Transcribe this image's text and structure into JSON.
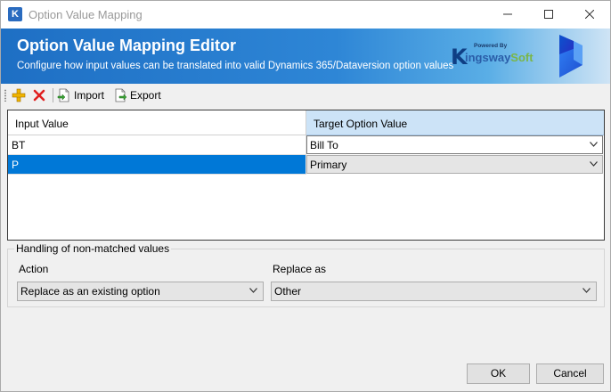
{
  "window": {
    "title": "Option Value Mapping",
    "app_icon_letter": "K"
  },
  "banner": {
    "title": "Option Value Mapping Editor",
    "subtitle": "Configure how input values can be translated into valid Dynamics 365/Dataversion option values",
    "brand": {
      "powered_by": "Powered By",
      "k_letter": "K",
      "name_part1": "ingsway",
      "name_part2": "Soft"
    }
  },
  "toolbar": {
    "import_label": "Import",
    "export_label": "Export"
  },
  "grid": {
    "columns": [
      "Input Value",
      "Target Option Value"
    ],
    "rows": [
      {
        "input": "BT",
        "target": "Bill To"
      },
      {
        "input": "P",
        "target": "Primary"
      }
    ]
  },
  "non_matched": {
    "legend": "Handling of non-matched values",
    "action_label": "Action",
    "action_value": "Replace as an existing option",
    "replace_label": "Replace as",
    "replace_value": "Other"
  },
  "buttons": {
    "ok": "OK",
    "cancel": "Cancel"
  },
  "colors": {
    "banner_start": "#1e6fc4",
    "selection": "#0078d7",
    "header_highlight": "#cce3f7"
  }
}
